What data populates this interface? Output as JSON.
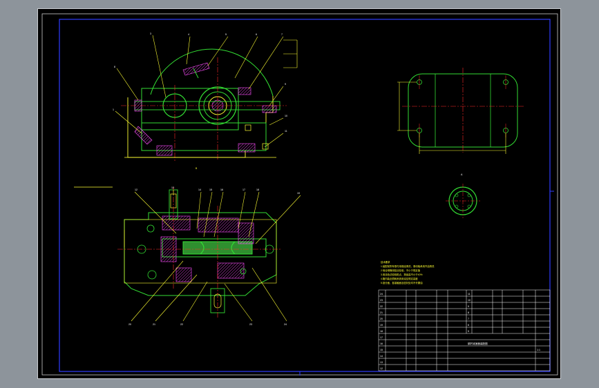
{
  "drawing": {
    "colors": {
      "background": "#000000",
      "frame": "#2f3cff",
      "outline": "#ffff33",
      "part": "#33dd33",
      "center_line": "#ff2a2a",
      "leader": "#ffff33",
      "hatch": "#ff4dff",
      "dimension": "#7fffd4"
    },
    "view_labels": {
      "section_mark": "B",
      "detail_mark": "A"
    },
    "technical_requirements": {
      "heading": "技术要求",
      "lines": [
        "1.装配前所有零件用煤油清洗，滚动轴承用汽油清洗",
        "2.啮合侧隙用铅丝检验，不小于规定值",
        "3.用涂色法检验斑点，按齿高不小于40%",
        "4.箱内装全损耗系统用油至规定高度",
        "5.剖分面、各接触面及密封处均不许漏油"
      ]
    },
    "title_block": {
      "name": "蜗杆减速器装配图",
      "scale": "1:1"
    }
  }
}
